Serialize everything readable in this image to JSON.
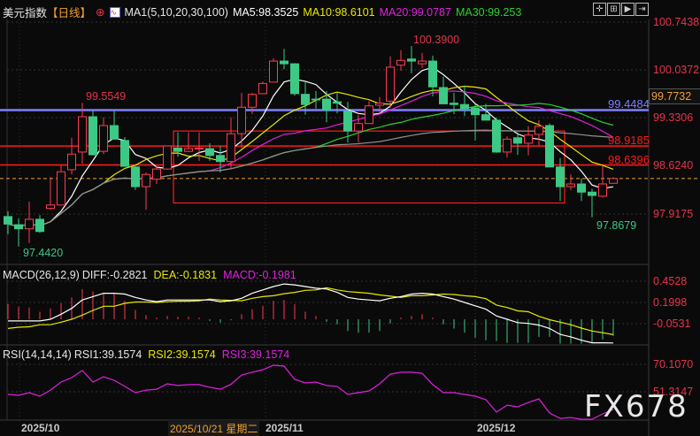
{
  "header": {
    "title": "美元指数",
    "period": "【日线】",
    "ma_label": "MA1(5,10,20,30,100)",
    "ma5": "MA5:98.3525",
    "ma10": "MA10:98.6101",
    "ma20": "MA20:99.0787",
    "ma30": "MA30:99.253"
  },
  "colors": {
    "up": "#ff3b52",
    "down": "#3cc985",
    "ma5": "#ffffff",
    "ma10": "#e8e800",
    "ma20": "#e020e0",
    "ma30": "#30d030",
    "ma100": "#909090",
    "support": "#ff1a1a",
    "blue_line": "#7f7fff",
    "current": "#f0a030"
  },
  "toolbar": [
    "crosshair-icon",
    "zoom-in-icon",
    "step-forward-icon",
    "move-right-icon"
  ],
  "price_axis": [
    "100.7438",
    "100.0372",
    "99.3306",
    "98.6240",
    "97.9175"
  ],
  "current_price_label": "99.7732",
  "annotations": {
    "high_main": "100.3900",
    "high_left": "99.5549",
    "low_left": "97.4420",
    "low_right": "97.8679",
    "blue_level": "99.4484",
    "red_level1": "98.9185",
    "red_level2": "98.6396"
  },
  "levels": {
    "blue": 99.4484,
    "red1": 98.9185,
    "red2": 98.6396,
    "current": 98.44,
    "box": {
      "from": 16,
      "to": 52,
      "top": 99.14,
      "bottom": 98.08
    }
  },
  "candles": [
    [
      97.88,
      97.96,
      97.62,
      97.77
    ],
    [
      97.76,
      97.85,
      97.442,
      97.7
    ],
    [
      97.7,
      98.1,
      97.49,
      97.84
    ],
    [
      97.84,
      97.9,
      97.64,
      97.66
    ],
    [
      98.0,
      98.46,
      97.98,
      98.05
    ],
    [
      98.05,
      98.63,
      98.05,
      98.54
    ],
    [
      98.57,
      99.04,
      98.5,
      98.8
    ],
    [
      98.83,
      99.5549,
      98.66,
      99.35
    ],
    [
      99.35,
      99.44,
      98.78,
      98.79
    ],
    [
      98.84,
      99.34,
      98.8,
      99.22
    ],
    [
      99.22,
      99.44,
      99.02,
      99.02
    ],
    [
      99.0,
      99.05,
      98.62,
      98.62
    ],
    [
      98.61,
      98.62,
      98.27,
      98.32
    ],
    [
      98.32,
      98.53,
      97.98,
      98.5
    ],
    [
      98.43,
      98.62,
      98.36,
      98.58
    ],
    [
      98.58,
      98.92,
      98.57,
      98.92
    ],
    [
      98.89,
      99.12,
      98.76,
      98.84
    ],
    [
      98.84,
      99.12,
      98.83,
      98.88
    ],
    [
      98.88,
      99.12,
      98.7,
      98.89
    ],
    [
      98.88,
      98.96,
      98.7,
      98.78
    ],
    [
      98.78,
      98.92,
      98.53,
      98.69
    ],
    [
      98.69,
      99.34,
      98.59,
      99.1
    ],
    [
      99.1,
      99.7,
      98.89,
      99.49
    ],
    [
      99.49,
      99.7,
      99.39,
      99.68
    ],
    [
      99.69,
      99.87,
      99.69,
      99.84
    ],
    [
      99.86,
      100.21,
      99.86,
      100.17
    ],
    [
      100.17,
      100.35,
      100.05,
      100.13
    ],
    [
      100.13,
      100.14,
      99.66,
      99.69
    ],
    [
      99.68,
      99.86,
      99.38,
      99.53
    ],
    [
      99.61,
      99.73,
      99.47,
      99.6
    ],
    [
      99.61,
      99.73,
      99.27,
      99.45
    ],
    [
      99.57,
      99.7,
      99.4,
      99.55
    ],
    [
      99.43,
      99.57,
      98.97,
      99.14
    ],
    [
      99.14,
      99.38,
      98.97,
      99.25
    ],
    [
      99.25,
      99.58,
      99.25,
      99.51
    ],
    [
      99.52,
      99.64,
      99.39,
      99.55
    ],
    [
      99.58,
      100.24,
      99.48,
      100.08
    ],
    [
      100.11,
      100.33,
      100.03,
      100.18
    ],
    [
      100.2,
      100.39,
      99.99,
      100.17
    ],
    [
      100.13,
      100.29,
      100.07,
      100.17
    ],
    [
      100.17,
      100.25,
      99.65,
      99.79
    ],
    [
      99.78,
      99.94,
      99.54,
      99.54
    ],
    [
      99.55,
      99.7,
      99.39,
      99.53
    ],
    [
      99.53,
      99.81,
      99.36,
      99.47
    ],
    [
      99.48,
      99.54,
      99.0,
      99.38
    ],
    [
      99.38,
      99.54,
      99.3,
      99.3
    ],
    [
      99.3,
      99.34,
      98.82,
      98.83
    ],
    [
      98.83,
      99.06,
      98.75,
      99.02
    ],
    [
      99.04,
      99.12,
      98.79,
      98.96
    ],
    [
      98.96,
      99.21,
      98.78,
      99.08
    ],
    [
      99.09,
      99.3,
      98.93,
      99.21
    ],
    [
      99.22,
      99.25,
      98.61,
      98.61
    ],
    [
      98.61,
      98.74,
      98.11,
      98.32
    ],
    [
      98.32,
      98.5,
      98.27,
      98.36
    ],
    [
      98.36,
      98.44,
      98.11,
      98.24
    ],
    [
      98.24,
      98.29,
      97.8679,
      98.19
    ],
    [
      98.18,
      98.62,
      98.16,
      98.36
    ],
    [
      98.37,
      98.46,
      98.37,
      98.44
    ]
  ],
  "macd": {
    "label": "MACD(26,12,9)",
    "diff_label": "DIFF:-0.2821",
    "dea_label": "DEA:-0.1831",
    "macd_label": "MACD:-0.1981",
    "axis": [
      "0.4528",
      "0.1998",
      "-0.0531"
    ],
    "diff": [
      -0.02,
      -0.02,
      -0.02,
      -0.02,
      0,
      0.06,
      0.13,
      0.23,
      0.27,
      0.31,
      0.31,
      0.3,
      0.26,
      0.23,
      0.21,
      0.23,
      0.23,
      0.23,
      0.23,
      0.23,
      0.21,
      0.22,
      0.25,
      0.31,
      0.35,
      0.39,
      0.42,
      0.41,
      0.39,
      0.37,
      0.36,
      0.32,
      0.26,
      0.24,
      0.23,
      0.22,
      0.25,
      0.27,
      0.3,
      0.31,
      0.3,
      0.27,
      0.24,
      0.2,
      0.16,
      0.12,
      0.04,
      0,
      -0.04,
      -0.05,
      -0.07,
      -0.11,
      -0.18,
      -0.21,
      -0.25,
      -0.28,
      -0.28,
      -0.2821
    ],
    "dea": [
      -0.11,
      -0.095,
      -0.09,
      -0.065,
      -0.065,
      -0.035,
      0,
      0.05,
      0.105,
      0.155,
      0.155,
      0.19,
      0.205,
      0.205,
      0.2,
      0.21,
      0.215,
      0.215,
      0.22,
      0.24,
      0.23,
      0.225,
      0.22,
      0.25,
      0.27,
      0.28,
      0.305,
      0.32,
      0.345,
      0.35,
      0.375,
      0.35,
      0.33,
      0.32,
      0.31,
      0.29,
      0.275,
      0.26,
      0.28,
      0.28,
      0.29,
      0.3,
      0.295,
      0.28,
      0.27,
      0.245,
      0.17,
      0.14,
      0.1,
      0.09,
      0.035,
      -0.005,
      -0.035,
      -0.065,
      -0.105,
      -0.14,
      -0.16,
      -0.1831
    ],
    "hist": [
      0.18,
      0.15,
      0.14,
      0.09,
      0.13,
      0.19,
      0.26,
      0.36,
      0.33,
      0.31,
      0.31,
      0.22,
      0.11,
      0.05,
      0.02,
      0.04,
      0.03,
      0.03,
      0.02,
      -0.02,
      -0.04,
      -0.01,
      0.06,
      0.12,
      0.16,
      0.22,
      0.23,
      0.18,
      0.09,
      0.04,
      -0.03,
      -0.06,
      -0.14,
      -0.16,
      -0.16,
      -0.14,
      -0.05,
      0.02,
      0.04,
      0.06,
      0.02,
      -0.06,
      -0.11,
      -0.16,
      -0.22,
      -0.25,
      -0.26,
      -0.28,
      -0.28,
      -0.28,
      -0.21,
      -0.21,
      -0.29,
      -0.29,
      -0.29,
      -0.28,
      -0.24,
      -0.1981
    ]
  },
  "rsi": {
    "label": "RSI(14,14,14)",
    "rsi1_label": "RSI1:39.1574",
    "rsi2_label": "RSI2:39.1574",
    "rsi3_label": "RSI3:39.1574",
    "axis": [
      "70.1070",
      "51.3147"
    ],
    "values": [
      49.5,
      48.9,
      50.7,
      48.3,
      52.5,
      58.0,
      61.0,
      65.9,
      58.0,
      61.6,
      59.2,
      55.0,
      50.7,
      52.5,
      53.1,
      56.8,
      55.6,
      56.2,
      56.2,
      54.4,
      53.1,
      56.4,
      62.8,
      64.7,
      66.5,
      69.5,
      68.9,
      59.8,
      57.4,
      58.0,
      55.6,
      55.0,
      49.5,
      50.7,
      51.9,
      56.8,
      63.4,
      64.7,
      64.7,
      64.0,
      56.2,
      50.7,
      50.7,
      49.5,
      48.3,
      45.9,
      37.4,
      42.2,
      41.0,
      44.0,
      46.5,
      36.8,
      33.1,
      33.7,
      32.5,
      32.5,
      36.2,
      39.1574
    ]
  },
  "dates": {
    "oct": "2025/10",
    "cursor": "2025/10/21 星期二",
    "nov": "2025/11",
    "dec": "2025/12"
  },
  "watermark": "FX678"
}
